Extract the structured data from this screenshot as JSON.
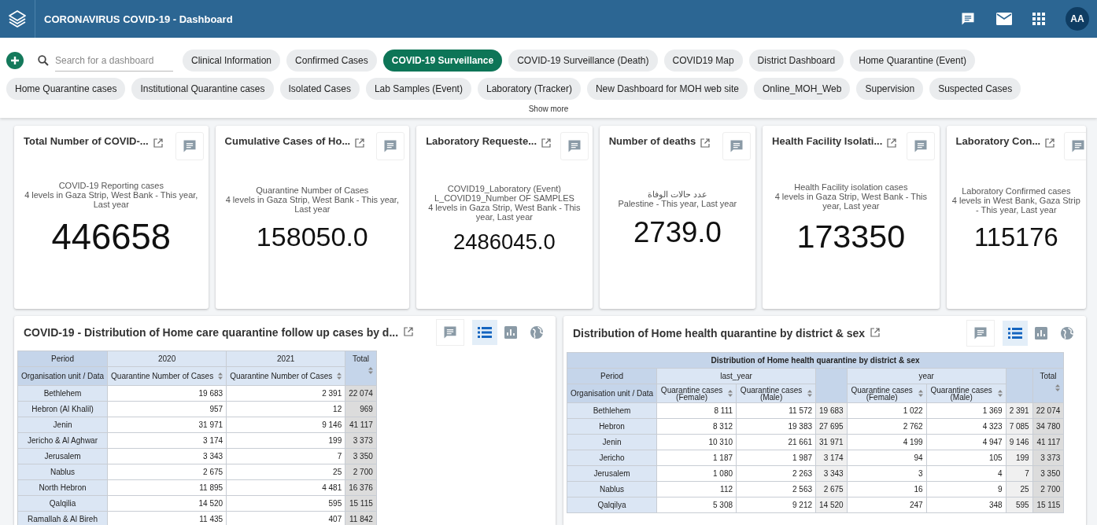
{
  "header": {
    "title": "CORONAVIRUS COVID-19 - Dashboard",
    "avatar": "AA"
  },
  "filter_bar": {
    "search": {
      "placeholder": "Search for a dashboard"
    },
    "dashboards": [
      {
        "label": "Clinical Information",
        "selected": false
      },
      {
        "label": "Confirmed Cases",
        "selected": false
      },
      {
        "label": "COVID-19 Surveillance",
        "selected": true
      },
      {
        "label": "COVID-19 Surveillance (Death)",
        "selected": false
      },
      {
        "label": "COVID19 Map",
        "selected": false
      },
      {
        "label": "District Dashboard",
        "selected": false
      },
      {
        "label": "Home Quarantine (Event)",
        "selected": false
      },
      {
        "label": "Home Quarantine cases",
        "selected": false
      },
      {
        "label": "Institutional Quarantine cases",
        "selected": false
      },
      {
        "label": "Isolated Cases",
        "selected": false
      },
      {
        "label": "Lab Samples (Event)",
        "selected": false
      },
      {
        "label": "Laboratory (Tracker)",
        "selected": false
      },
      {
        "label": "New Dashboard for MOH web site",
        "selected": false
      },
      {
        "label": "Online_MOH_Web",
        "selected": false
      },
      {
        "label": "Supervision",
        "selected": false
      },
      {
        "label": "Suspected Cases",
        "selected": false
      }
    ],
    "show_more": "Show more"
  },
  "cards": [
    {
      "title": "Total Number of COVID-...",
      "lines": [
        "COVID-19 Reporting cases",
        "4 levels in Gaza Strip, West Bank - This year, Last year"
      ],
      "value": "446658"
    },
    {
      "title": "Cumulative Cases of Ho...",
      "lines": [
        "Quarantine Number of Cases",
        "4 levels in Gaza Strip, West Bank - This year, Last year"
      ],
      "value": "158050.0"
    },
    {
      "title": "Laboratory Requeste...",
      "lines": [
        "COVID19_Laboratory (Event) L_COVID19_Number OF SAMPLES",
        "4 levels in Gaza Strip, West Bank - This year, Last year"
      ],
      "value": "2486045.0"
    },
    {
      "title": "Number of deaths",
      "lines": [
        "عدد حالات الوفاة",
        "Palestine - This year, Last year"
      ],
      "value": "2739.0"
    },
    {
      "title": "Health Facility Isolati...",
      "lines": [
        "Health Facility isolation cases",
        "4 levels in Gaza Strip, West Bank - This year, Last year"
      ],
      "value": "173350"
    },
    {
      "title": "Laboratory Con...",
      "lines": [
        "Laboratory Confirmed cases",
        "4 levels in West Bank, Gaza Strip - This year, Last year"
      ],
      "value": "115176"
    }
  ],
  "panels": [
    {
      "title": "COVID-19 - Distribution of Home care quarantine follow up cases by d...",
      "views": [
        {
          "kind": "table",
          "selected": true
        },
        {
          "kind": "chart",
          "selected": false
        },
        {
          "kind": "map",
          "selected": false
        }
      ],
      "table": {
        "subtotals": false,
        "period_header": "Period",
        "unit_header": "Organisation unit / Data",
        "total_header": "Total",
        "periods": [
          {
            "label": "2020",
            "columns": [
              "Quarantine Number of Cases"
            ]
          },
          {
            "label": "2021",
            "columns": [
              "Quarantine Number of Cases"
            ]
          }
        ],
        "rows": [
          {
            "name": "Bethlehem",
            "cells": [
              "19 683",
              "2 391",
              "22 074"
            ]
          },
          {
            "name": "Hebron (Al Khalil)",
            "cells": [
              "957",
              "12",
              "969"
            ]
          },
          {
            "name": "Jenin",
            "cells": [
              "31 971",
              "9 146",
              "41 117"
            ]
          },
          {
            "name": "Jericho & Al Aghwar",
            "cells": [
              "3 174",
              "199",
              "3 373"
            ]
          },
          {
            "name": "Jerusalem",
            "cells": [
              "3 343",
              "7",
              "3 350"
            ]
          },
          {
            "name": "Nablus",
            "cells": [
              "2 675",
              "25",
              "2 700"
            ]
          },
          {
            "name": "North Hebron",
            "cells": [
              "11 895",
              "4 481",
              "16 376"
            ]
          },
          {
            "name": "Qalqilia",
            "cells": [
              "14 520",
              "595",
              "15 115"
            ]
          },
          {
            "name": "Ramallah & Al Bireh",
            "cells": [
              "11 435",
              "407",
              "11 842"
            ]
          }
        ]
      }
    },
    {
      "title": "Distribution of Home health quarantine by district & sex",
      "views": [
        {
          "kind": "table",
          "selected": true
        },
        {
          "kind": "chart",
          "selected": false
        },
        {
          "kind": "map",
          "selected": false
        }
      ],
      "table": {
        "title": "Distribution of Home health quarantine by district & sex",
        "subtotals": true,
        "period_header": "Period",
        "unit_header": "Organisation unit / Data",
        "total_header": "Total",
        "periods": [
          {
            "label": "last_year",
            "columns": [
              "Quarantine cases (Female)",
              "Quarantine cases (Male)"
            ]
          },
          {
            "label": "year",
            "columns": [
              "Quarantine cases (Female)",
              "Quarantine cases (Male)"
            ]
          }
        ],
        "rows": [
          {
            "name": "Bethlehem",
            "cells": [
              "8 111",
              "11 572",
              "19 683",
              "1 022",
              "1 369",
              "2 391",
              "22 074"
            ]
          },
          {
            "name": "Hebron",
            "cells": [
              "8 312",
              "19 383",
              "27 695",
              "2 762",
              "4 323",
              "7 085",
              "34 780"
            ]
          },
          {
            "name": "Jenin",
            "cells": [
              "10 310",
              "21 661",
              "31 971",
              "4 199",
              "4 947",
              "9 146",
              "41 117"
            ]
          },
          {
            "name": "Jericho",
            "cells": [
              "1 187",
              "1 987",
              "3 174",
              "94",
              "105",
              "199",
              "3 373"
            ]
          },
          {
            "name": "Jerusalem",
            "cells": [
              "1 080",
              "2 263",
              "3 343",
              "3",
              "4",
              "7",
              "3 350"
            ]
          },
          {
            "name": "Nablus",
            "cells": [
              "112",
              "2 563",
              "2 675",
              "16",
              "9",
              "25",
              "2 700"
            ]
          },
          {
            "name": "Qalqilya",
            "cells": [
              "5 308",
              "9 212",
              "14 520",
              "247",
              "348",
              "595",
              "15 115"
            ]
          }
        ]
      }
    }
  ]
}
